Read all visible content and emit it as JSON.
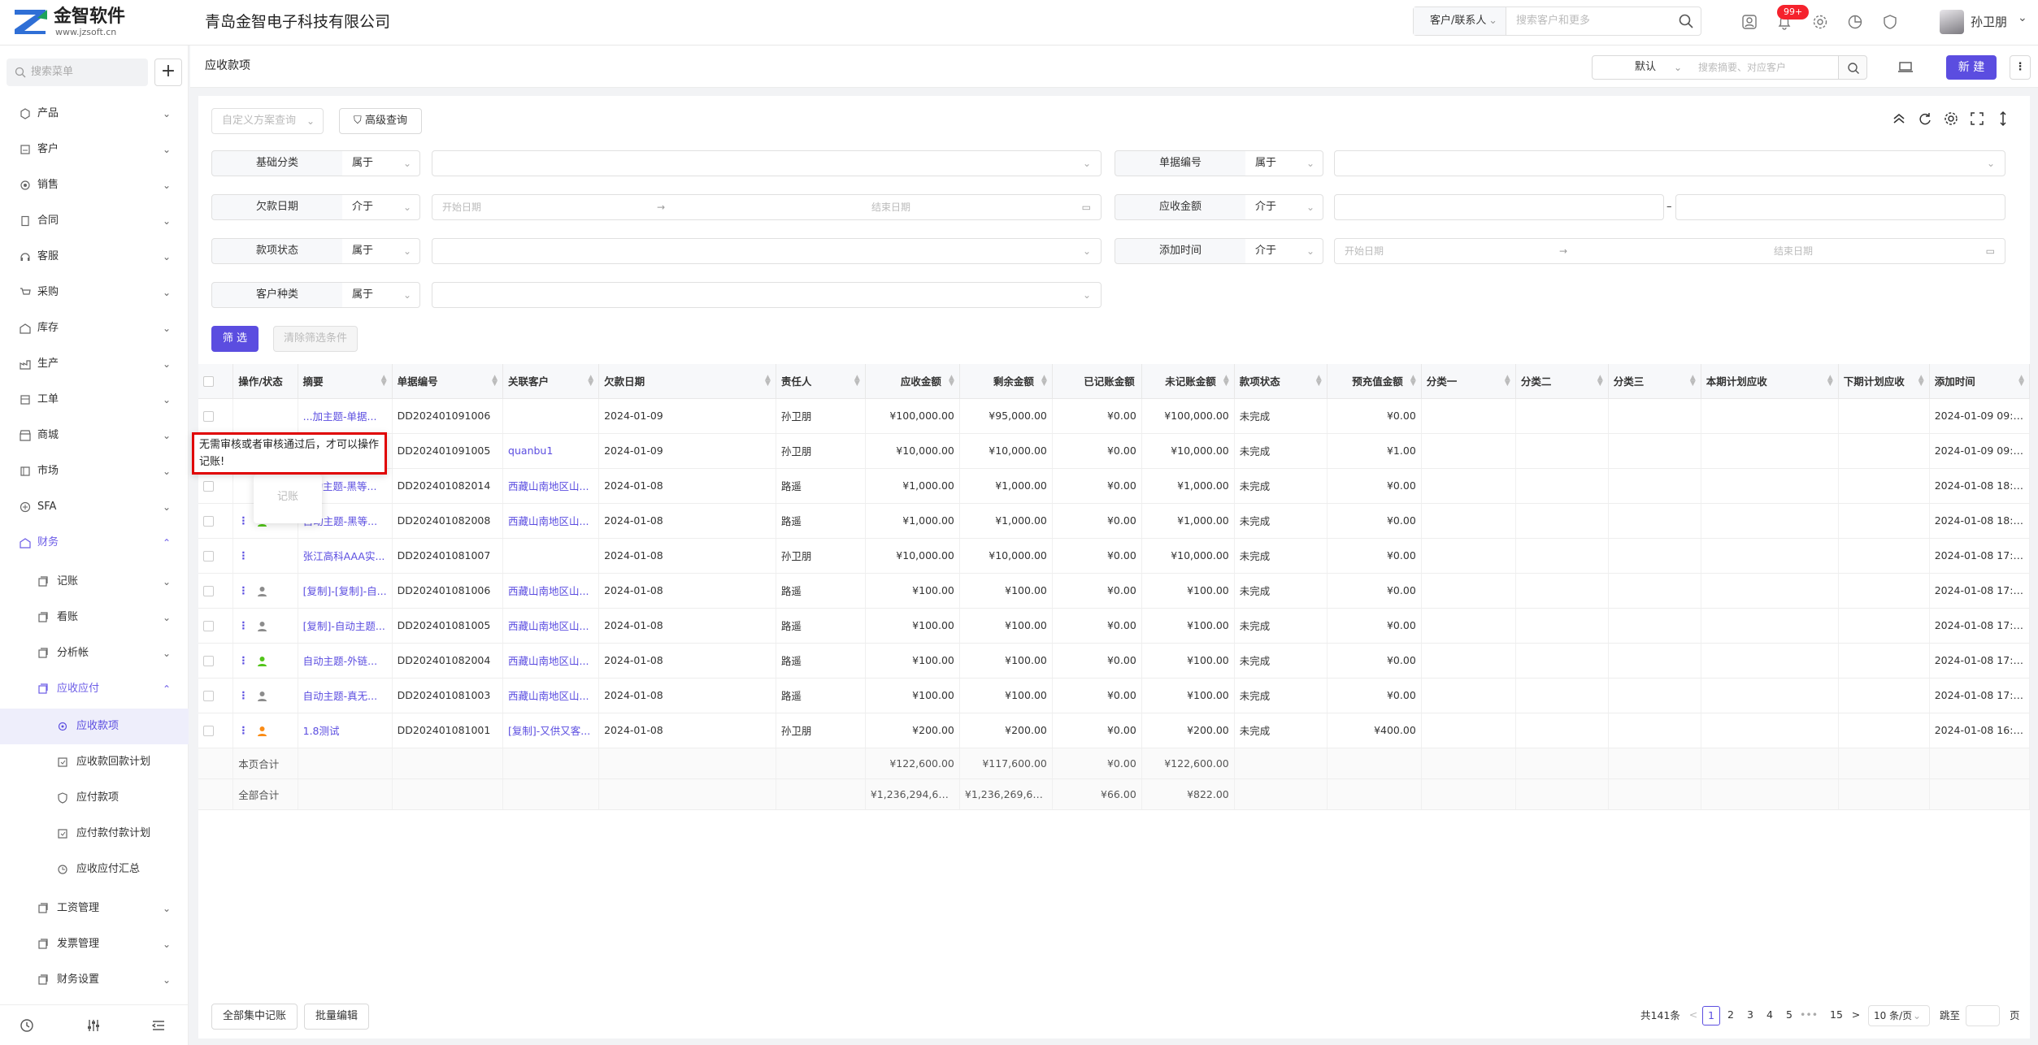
{
  "app": {
    "logo_name": "金智软件",
    "logo_url": "www.jzsoft.cn",
    "company": "青岛金智电子科技有限公司"
  },
  "topbar": {
    "search_scope": "客户/联系人",
    "search_placeholder": "搜索客户和更多",
    "notification_badge": "99+",
    "user_name": "孙卫朋"
  },
  "sidebar": {
    "search_placeholder": "搜索菜单",
    "add_label": "+",
    "items": [
      {
        "label": "产品"
      },
      {
        "label": "客户"
      },
      {
        "label": "销售"
      },
      {
        "label": "合同"
      },
      {
        "label": "客服"
      },
      {
        "label": "采购"
      },
      {
        "label": "库存"
      },
      {
        "label": "生产"
      },
      {
        "label": "工单"
      },
      {
        "label": "商城"
      },
      {
        "label": "市场"
      },
      {
        "label": "SFA"
      },
      {
        "label": "财务"
      }
    ],
    "finance_children": [
      {
        "label": "记账"
      },
      {
        "label": "看账"
      },
      {
        "label": "分析帐"
      },
      {
        "label": "应收应付"
      }
    ],
    "ar_children": [
      {
        "label": "应收款项"
      },
      {
        "label": "应收款回款计划"
      },
      {
        "label": "应付款项"
      },
      {
        "label": "应付款付款计划"
      },
      {
        "label": "应收应付汇总"
      }
    ],
    "finance_tail": [
      {
        "label": "工资管理"
      },
      {
        "label": "发票管理"
      },
      {
        "label": "财务设置"
      }
    ]
  },
  "header": {
    "title": "应收款项",
    "view_select": "默认",
    "search_placeholder": "搜索摘要、对应客户",
    "new_label": "新 建",
    "more_label": "⋮"
  },
  "filters": {
    "custom_query_placeholder": "自定义方案查询",
    "advanced_query": "高级查询",
    "rows": [
      {
        "label": "基础分类",
        "op": "属于"
      },
      {
        "label": "单据编号",
        "op": "属于"
      },
      {
        "label": "欠款日期",
        "op": "介于",
        "start": "开始日期",
        "end": "结束日期"
      },
      {
        "label": "应收金额",
        "op": "介于"
      },
      {
        "label": "款项状态",
        "op": "属于"
      },
      {
        "label": "添加时间",
        "op": "介于",
        "start": "开始日期",
        "end": "结束日期"
      },
      {
        "label": "客户种类",
        "op": "属于"
      }
    ],
    "range_arrow": "→",
    "range_dash": "–",
    "filter_btn": "筛 选",
    "clear_btn": "清除筛选条件"
  },
  "table": {
    "columns": [
      "操作/状态",
      "摘要",
      "单据编号",
      "关联客户",
      "欠款日期",
      "责任人",
      "应收金额",
      "剩余金额",
      "已记账金额",
      "未记账金额",
      "款项状态",
      "预充值金额",
      "分类一",
      "分类二",
      "分类三",
      "本期计划应收",
      "下期计划应收",
      "添加时间"
    ],
    "rows": [
      {
        "summary": "...加主题-单据...",
        "no": "DD202401091006",
        "customer": "",
        "date": "2024-01-09",
        "owner": "孙卫朋",
        "amount": "¥100,000.00",
        "remain": "¥95,000.00",
        "posted": "¥0.00",
        "unposted": "¥100,000.00",
        "status": "未完成",
        "prepaid": "¥0.00",
        "added": "2024-01-09 09:3..."
      },
      {
        "summary": "",
        "no": "DD202401091005",
        "customer": "quanbu1",
        "date": "2024-01-09",
        "owner": "孙卫朋",
        "amount": "¥10,000.00",
        "remain": "¥10,000.00",
        "posted": "¥0.00",
        "unposted": "¥10,000.00",
        "status": "未完成",
        "prepaid": "¥1.00",
        "added": "2024-01-09 09:3..."
      },
      {
        "summary": "...动主题-黑等...",
        "no": "DD202401082014",
        "customer": "西藏山南地区山...",
        "date": "2024-01-08",
        "owner": "路遥",
        "amount": "¥1,000.00",
        "remain": "¥1,000.00",
        "posted": "¥0.00",
        "unposted": "¥1,000.00",
        "status": "未完成",
        "prepaid": "¥0.00",
        "added": "2024-01-08 18:4..."
      },
      {
        "summary": "自动主题-黑等...",
        "no": "DD202401082008",
        "customer": "西藏山南地区山...",
        "date": "2024-01-08",
        "owner": "路遥",
        "amount": "¥1,000.00",
        "remain": "¥1,000.00",
        "posted": "¥0.00",
        "unposted": "¥1,000.00",
        "status": "未完成",
        "prepaid": "¥0.00",
        "added": "2024-01-08 18:1..."
      },
      {
        "summary": "张江高科AAA实...",
        "no": "DD202401081007",
        "customer": "",
        "date": "2024-01-08",
        "owner": "孙卫朋",
        "amount": "¥10,000.00",
        "remain": "¥10,000.00",
        "posted": "¥0.00",
        "unposted": "¥10,000.00",
        "status": "未完成",
        "prepaid": "¥0.00",
        "added": "2024-01-08 17:4..."
      },
      {
        "summary": "[复制]-[复制]-自...",
        "no": "DD202401081006",
        "customer": "西藏山南地区山...",
        "date": "2024-01-08",
        "owner": "路遥",
        "amount": "¥100.00",
        "remain": "¥100.00",
        "posted": "¥0.00",
        "unposted": "¥100.00",
        "status": "未完成",
        "prepaid": "¥0.00",
        "added": "2024-01-08 17:3..."
      },
      {
        "summary": "[复制]-自动主题...",
        "no": "DD202401081005",
        "customer": "西藏山南地区山...",
        "date": "2024-01-08",
        "owner": "路遥",
        "amount": "¥100.00",
        "remain": "¥100.00",
        "posted": "¥0.00",
        "unposted": "¥100.00",
        "status": "未完成",
        "prepaid": "¥0.00",
        "added": "2024-01-08 17:3..."
      },
      {
        "summary": "自动主题-外链...",
        "no": "DD202401082004",
        "customer": "西藏山南地区山...",
        "date": "2024-01-08",
        "owner": "路遥",
        "amount": "¥100.00",
        "remain": "¥100.00",
        "posted": "¥0.00",
        "unposted": "¥100.00",
        "status": "未完成",
        "prepaid": "¥0.00",
        "added": "2024-01-08 17:3..."
      },
      {
        "summary": "自动主题-真无...",
        "no": "DD202401081003",
        "customer": "西藏山南地区山...",
        "date": "2024-01-08",
        "owner": "路遥",
        "amount": "¥100.00",
        "remain": "¥100.00",
        "posted": "¥0.00",
        "unposted": "¥100.00",
        "status": "未完成",
        "prepaid": "¥0.00",
        "added": "2024-01-08 17:3..."
      },
      {
        "summary": "1.8测试",
        "no": "DD202401081001",
        "customer": "[复制]-又供又客...",
        "date": "2024-01-08",
        "owner": "孙卫朋",
        "amount": "¥200.00",
        "remain": "¥200.00",
        "posted": "¥0.00",
        "unposted": "¥200.00",
        "status": "未完成",
        "prepaid": "¥400.00",
        "added": "2024-01-08 16:5..."
      }
    ],
    "page_total": {
      "label": "本页合计",
      "amount": "¥122,600.00",
      "remain": "¥117,600.00",
      "posted": "¥0.00",
      "unposted": "¥122,600.00"
    },
    "all_total": {
      "label": "全部合计",
      "amount": "¥1,236,294,616...",
      "remain": "¥1,236,269,656...",
      "posted": "¥66.00",
      "unposted": "¥822.00"
    }
  },
  "tooltip": {
    "text": "无需审核或者审核通过后，才可以操作记账!",
    "popover_label": "记账"
  },
  "footer": {
    "batch_post": "全部集中记账",
    "batch_edit": "批量编辑",
    "total": "共141条",
    "pages": [
      "1",
      "2",
      "3",
      "4",
      "5",
      "•••",
      "15"
    ],
    "prev": "<",
    "next": ">",
    "page_size": "10 条/页",
    "jump_label": "跳至",
    "page_unit": "页"
  },
  "colors": {
    "accent": "#5b4de0",
    "tooltip_border": "#e00000",
    "badge": "#f5222d",
    "person_green": "#52c41a",
    "person_orange": "#fa8c16",
    "person_gray": "#8c8c8c"
  }
}
